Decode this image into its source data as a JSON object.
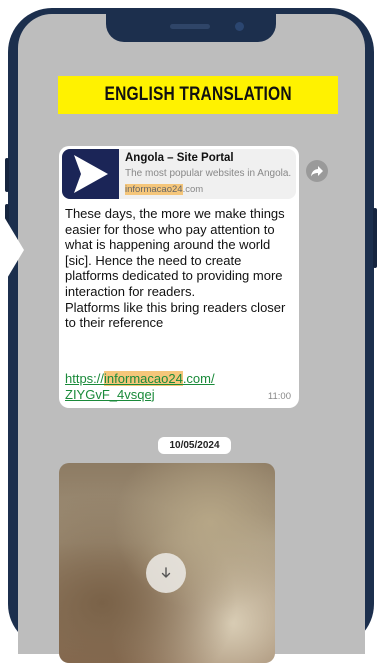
{
  "banner": {
    "title": "ENGLISH TRANSLATION"
  },
  "message": {
    "preview": {
      "title": "Angola – Site Portal",
      "description": "The most popular websites in Angola.",
      "domain_highlight": "informacao24",
      "domain_rest": ".com"
    },
    "paragraphs": [
      "These days, the more we make things easier for those who pay attention to what is happening around the world [sic]. Hence the need to create platforms dedicated to providing more interaction for readers.",
      "Platforms like this bring readers closer to their reference"
    ],
    "link": {
      "prefix": "https://",
      "highlight": "informacao24",
      "suffix": ".com/",
      "path": "ZIYGvF_4vsqej"
    },
    "time": "11:00"
  },
  "date_separator": "10/05/2024",
  "icons": {
    "forward": "forward-icon",
    "download": "download-icon",
    "link_preview": "play-logo-icon"
  },
  "colors": {
    "banner_bg": "#fff200",
    "phone_frame": "#1c2f4d",
    "chat_bg": "#bdbdbd",
    "link_green": "#1a8a3a",
    "highlight": "#f5c67a"
  }
}
